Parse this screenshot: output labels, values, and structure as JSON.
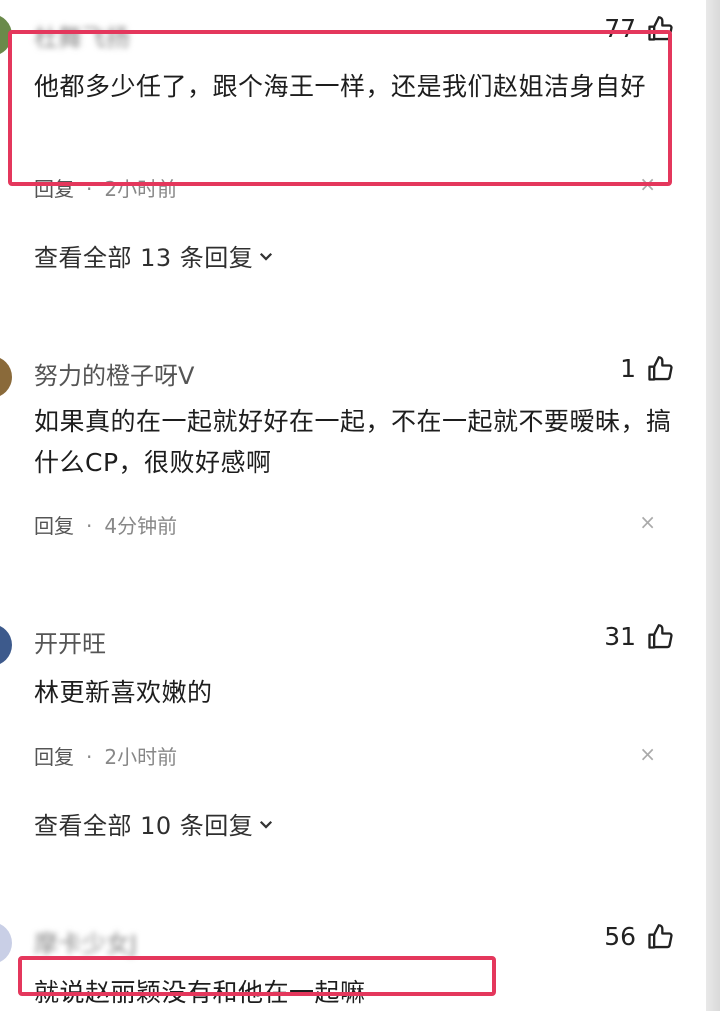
{
  "comments": [
    {
      "username": "杜舞飞扬",
      "likes": "77",
      "text": "他都多少任了，跟个海王一样，还是我们赵姐洁身自好",
      "reply_label": "回复",
      "time": "2小时前",
      "view_replies": "查看全部 13 条回复"
    },
    {
      "username": "努力的橙子呀V",
      "likes": "1",
      "text": "如果真的在一起就好好在一起，不在一起就不要暧昧，搞什么CP，很败好感啊",
      "reply_label": "回复",
      "time": "4分钟前"
    },
    {
      "username": "开开旺",
      "likes": "31",
      "text": "林更新喜欢嫩的",
      "reply_label": "回复",
      "time": "2小时前",
      "view_replies": "查看全部 10 条回复"
    },
    {
      "username": "摩卡少女J",
      "likes": "56",
      "text": "就说赵丽颖没有和他在一起嘛"
    }
  ],
  "separator": "·",
  "close_glyph": "×",
  "colors": {
    "highlight_border": "#e4375c",
    "meta_text": "#888888",
    "body_text": "#1d1d1d"
  },
  "icons": {
    "like": "thumbs-up-icon",
    "dismiss": "close-icon",
    "expand": "chevron-down-icon"
  }
}
